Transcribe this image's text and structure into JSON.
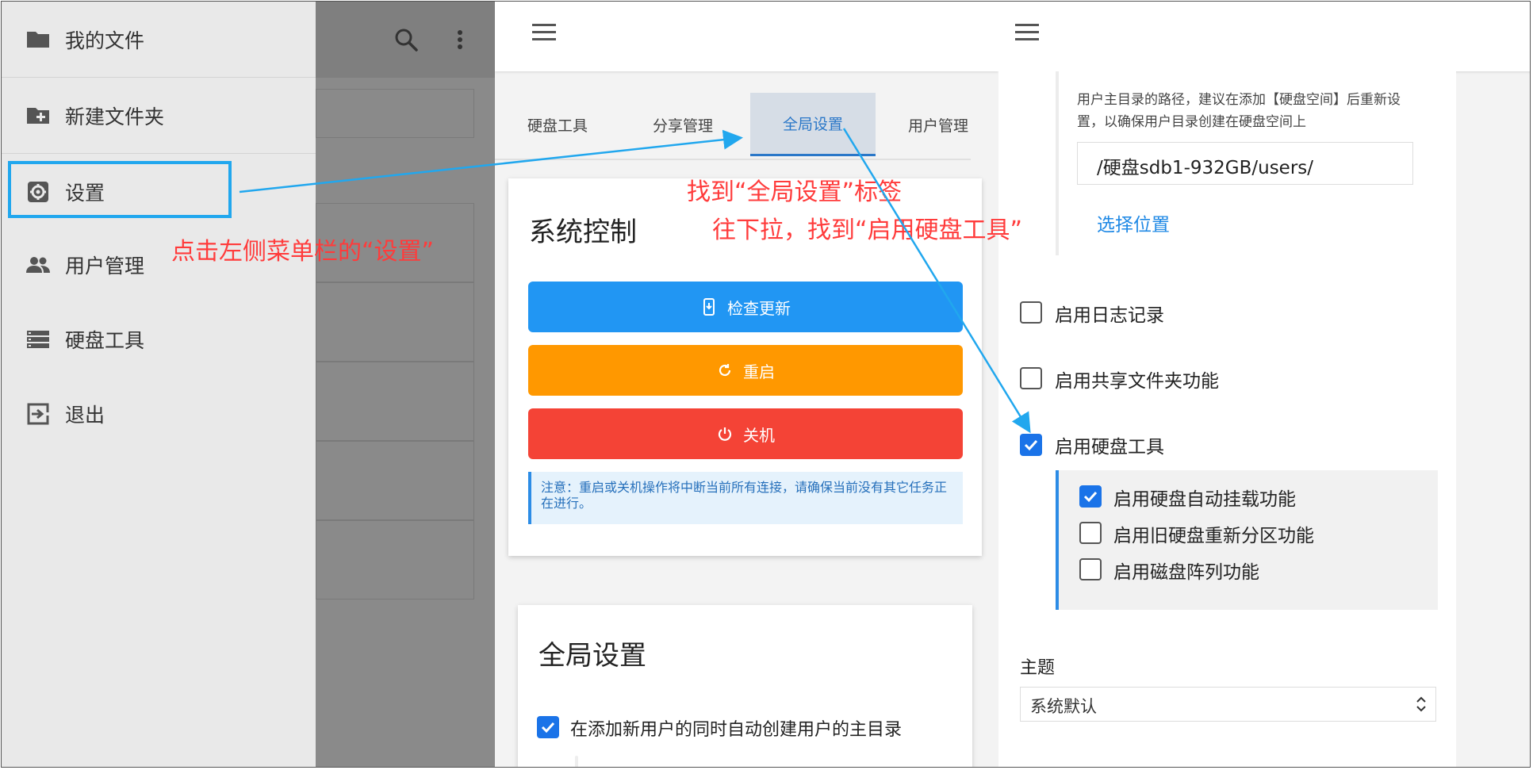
{
  "drawer": {
    "items": [
      {
        "label": "我的文件"
      },
      {
        "label": "新建文件夹"
      },
      {
        "label": "设置"
      },
      {
        "label": "用户管理"
      },
      {
        "label": "硬盘工具"
      },
      {
        "label": "退出"
      }
    ]
  },
  "tabs": [
    "硬盘工具",
    "分享管理",
    "全局设置",
    "用户管理"
  ],
  "system_control": {
    "title": "系统控制",
    "check_update": "检查更新",
    "restart": "重启",
    "shutdown": "关机",
    "note": "注意：重启或关机操作将中断当前所有连接，请确保当前没有其它任务正在进行。"
  },
  "global_settings": {
    "title": "全局设置",
    "auto_home": "在添加新用户的同时自动创建用户的主目录"
  },
  "settings_panel": {
    "home_hint": "用户主目录的路径，建议在添加【硬盘空间】后重新设置，以确保用户目录创建在硬盘空间上",
    "home_path": "/硬盘sdb1-932GB/users/",
    "choose_location": "选择位置",
    "enable_log": "启用日志记录",
    "enable_share": "启用共享文件夹功能",
    "enable_disk_tools": "启用硬盘工具",
    "sub_options": {
      "auto_mount": "启用硬盘自动挂载功能",
      "repartition": "启用旧硬盘重新分区功能",
      "raid": "启用磁盘阵列功能"
    },
    "theme_label": "主题",
    "theme_value": "系统默认"
  },
  "checkbox_states": {
    "auto_home": true,
    "enable_log": false,
    "enable_share": false,
    "enable_disk_tools": true,
    "auto_mount": true,
    "repartition": false,
    "raid": false
  },
  "annotations": {
    "step1": "点击左侧菜单栏的“设置”",
    "step2": "找到“全局设置”标签",
    "step3": "往下拉，找到“启用硬盘工具”"
  },
  "colors": {
    "primary_blue": "#2196f3",
    "orange": "#ff9800",
    "red": "#f44336",
    "annotation_red": "#ff3b3b",
    "annotation_blue": "#21a7ee",
    "checkbox_blue": "#1a73e8"
  }
}
